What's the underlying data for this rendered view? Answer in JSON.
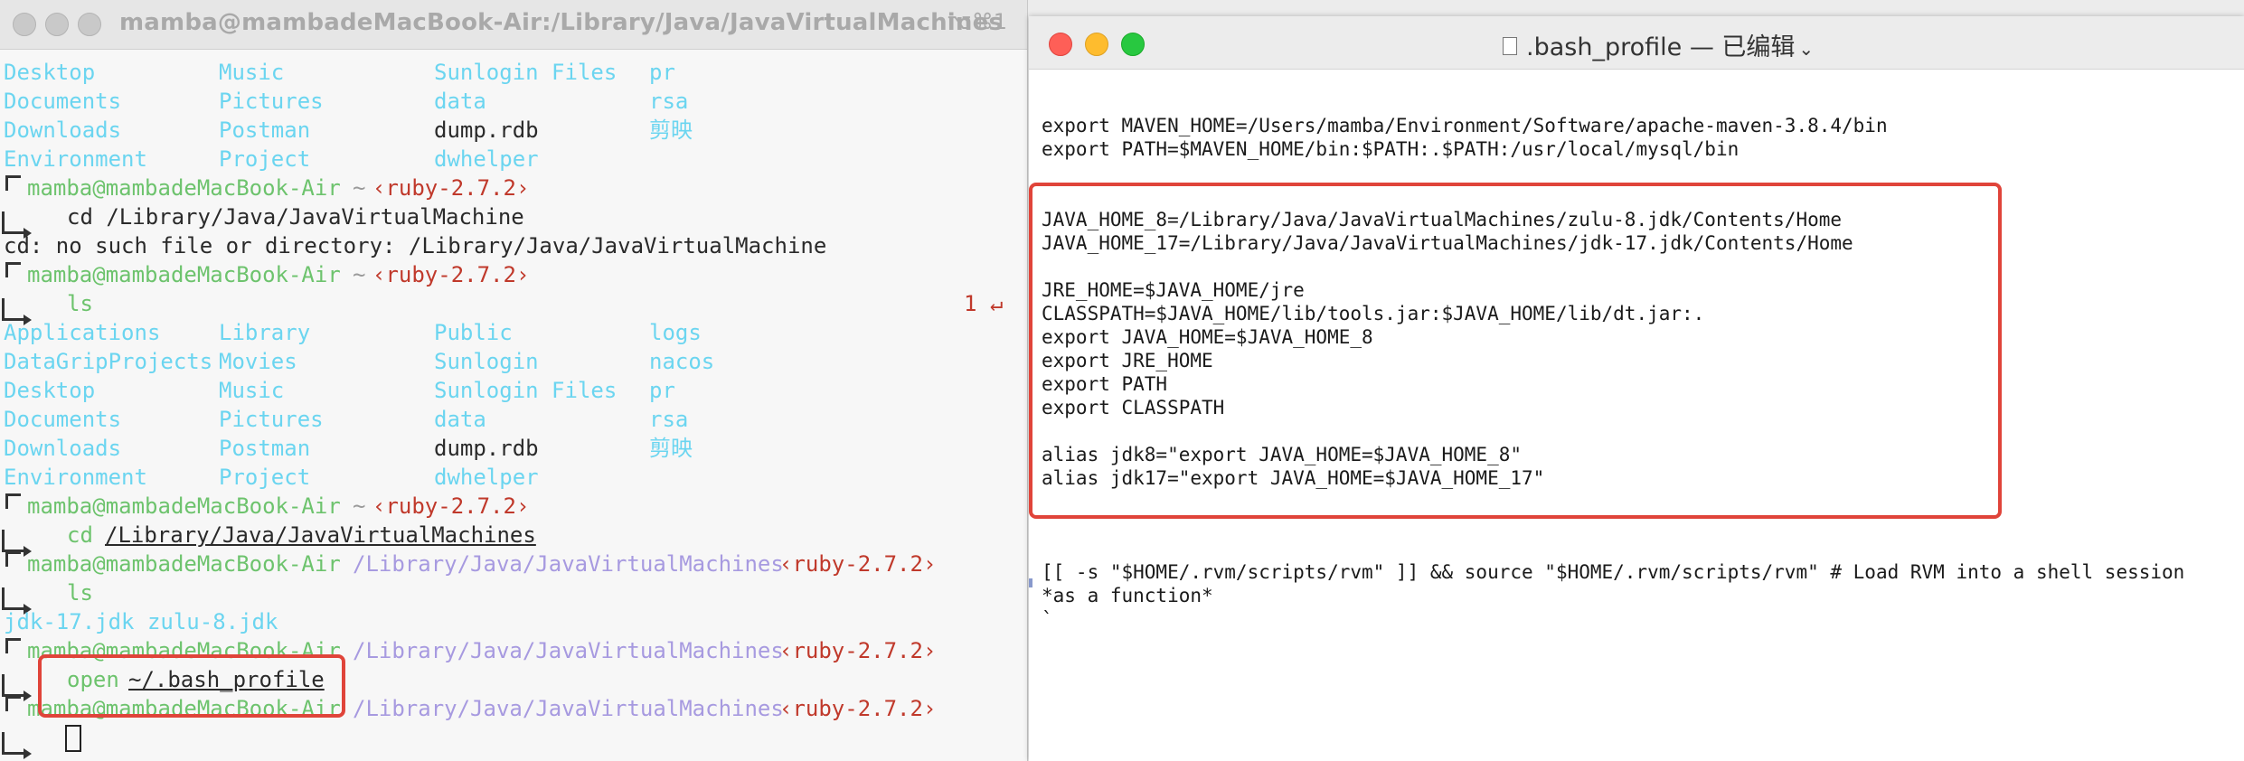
{
  "terminal": {
    "title": "mamba@mambadeMacBook-Air:/Library/Java/JavaVirtualMachines",
    "shortcut": "⌥⌘1",
    "listing_top": [
      [
        "Desktop",
        "Music",
        "Sunlogin Files",
        "pr"
      ],
      [
        "Documents",
        "Pictures",
        "data",
        "rsa"
      ],
      [
        "Downloads",
        "Postman",
        "dump.rdb",
        "剪映"
      ],
      [
        "Environment",
        "Project",
        "dwhelper",
        ""
      ]
    ],
    "prompt_user": "mamba@mambadeMacBook-Air",
    "tilde": "~",
    "ruby": "‹ruby-2.7.2›",
    "cmd1": "cd /Library/Java/JavaVirtualMachine",
    "err1": "cd: no such file or directory: /Library/Java/JavaVirtualMachine",
    "ls_cmd": "ls",
    "exit_code": "1 ↵",
    "listing_full": [
      [
        "Applications",
        "Library",
        "Public",
        "logs"
      ],
      [
        "DataGripProjects",
        "Movies",
        "Sunlogin",
        "nacos"
      ],
      [
        "Desktop",
        "Music",
        "Sunlogin Files",
        "pr"
      ],
      [
        "Documents",
        "Pictures",
        "data",
        "rsa"
      ],
      [
        "Downloads",
        "Postman",
        "dump.rdb",
        "剪映"
      ],
      [
        "Environment",
        "Project",
        "dwhelper",
        ""
      ]
    ],
    "cmd_cd_prefix": "cd ",
    "cmd_cd_path": "/Library/Java/JavaVirtualMachines",
    "jvm_path": "/Library/Java/JavaVirtualMachines",
    "jdk_listing": "jdk-17.jdk zulu-8.jdk",
    "open_cmd": "open",
    "open_arg": "~/.bash_profile"
  },
  "editor": {
    "title": ".bash_profile — 已编辑",
    "lines": [
      "export MAVEN_HOME=/Users/mamba/Environment/Software/apache-maven-3.8.4/bin",
      "export PATH=$MAVEN_HOME/bin:$PATH:.$PATH:/usr/local/mysql/bin",
      "",
      "",
      "JAVA_HOME_8=/Library/Java/JavaVirtualMachines/zulu-8.jdk/Contents/Home",
      "JAVA_HOME_17=/Library/Java/JavaVirtualMachines/jdk-17.jdk/Contents/Home",
      "",
      "JRE_HOME=$JAVA_HOME/jre",
      "CLASSPATH=$JAVA_HOME/lib/tools.jar:$JAVA_HOME/lib/dt.jar:.",
      "export JAVA_HOME=$JAVA_HOME_8",
      "export JRE_HOME",
      "export PATH",
      "export CLASSPATH",
      "",
      "alias jdk8=\"export JAVA_HOME=$JAVA_HOME_8\"",
      "alias jdk17=\"export JAVA_HOME=$JAVA_HOME_17\"",
      "",
      "",
      "",
      "[[ -s \"$HOME/.rvm/scripts/rvm\" ]] && source \"$HOME/.rvm/scripts/rvm\" # Load RVM into a shell session",
      "*as a function*",
      "`"
    ]
  },
  "colors": {
    "highlight_box": "#e0443a",
    "traffic_close": "#fe5f57",
    "traffic_min": "#febc2e",
    "traffic_max": "#28c840"
  }
}
